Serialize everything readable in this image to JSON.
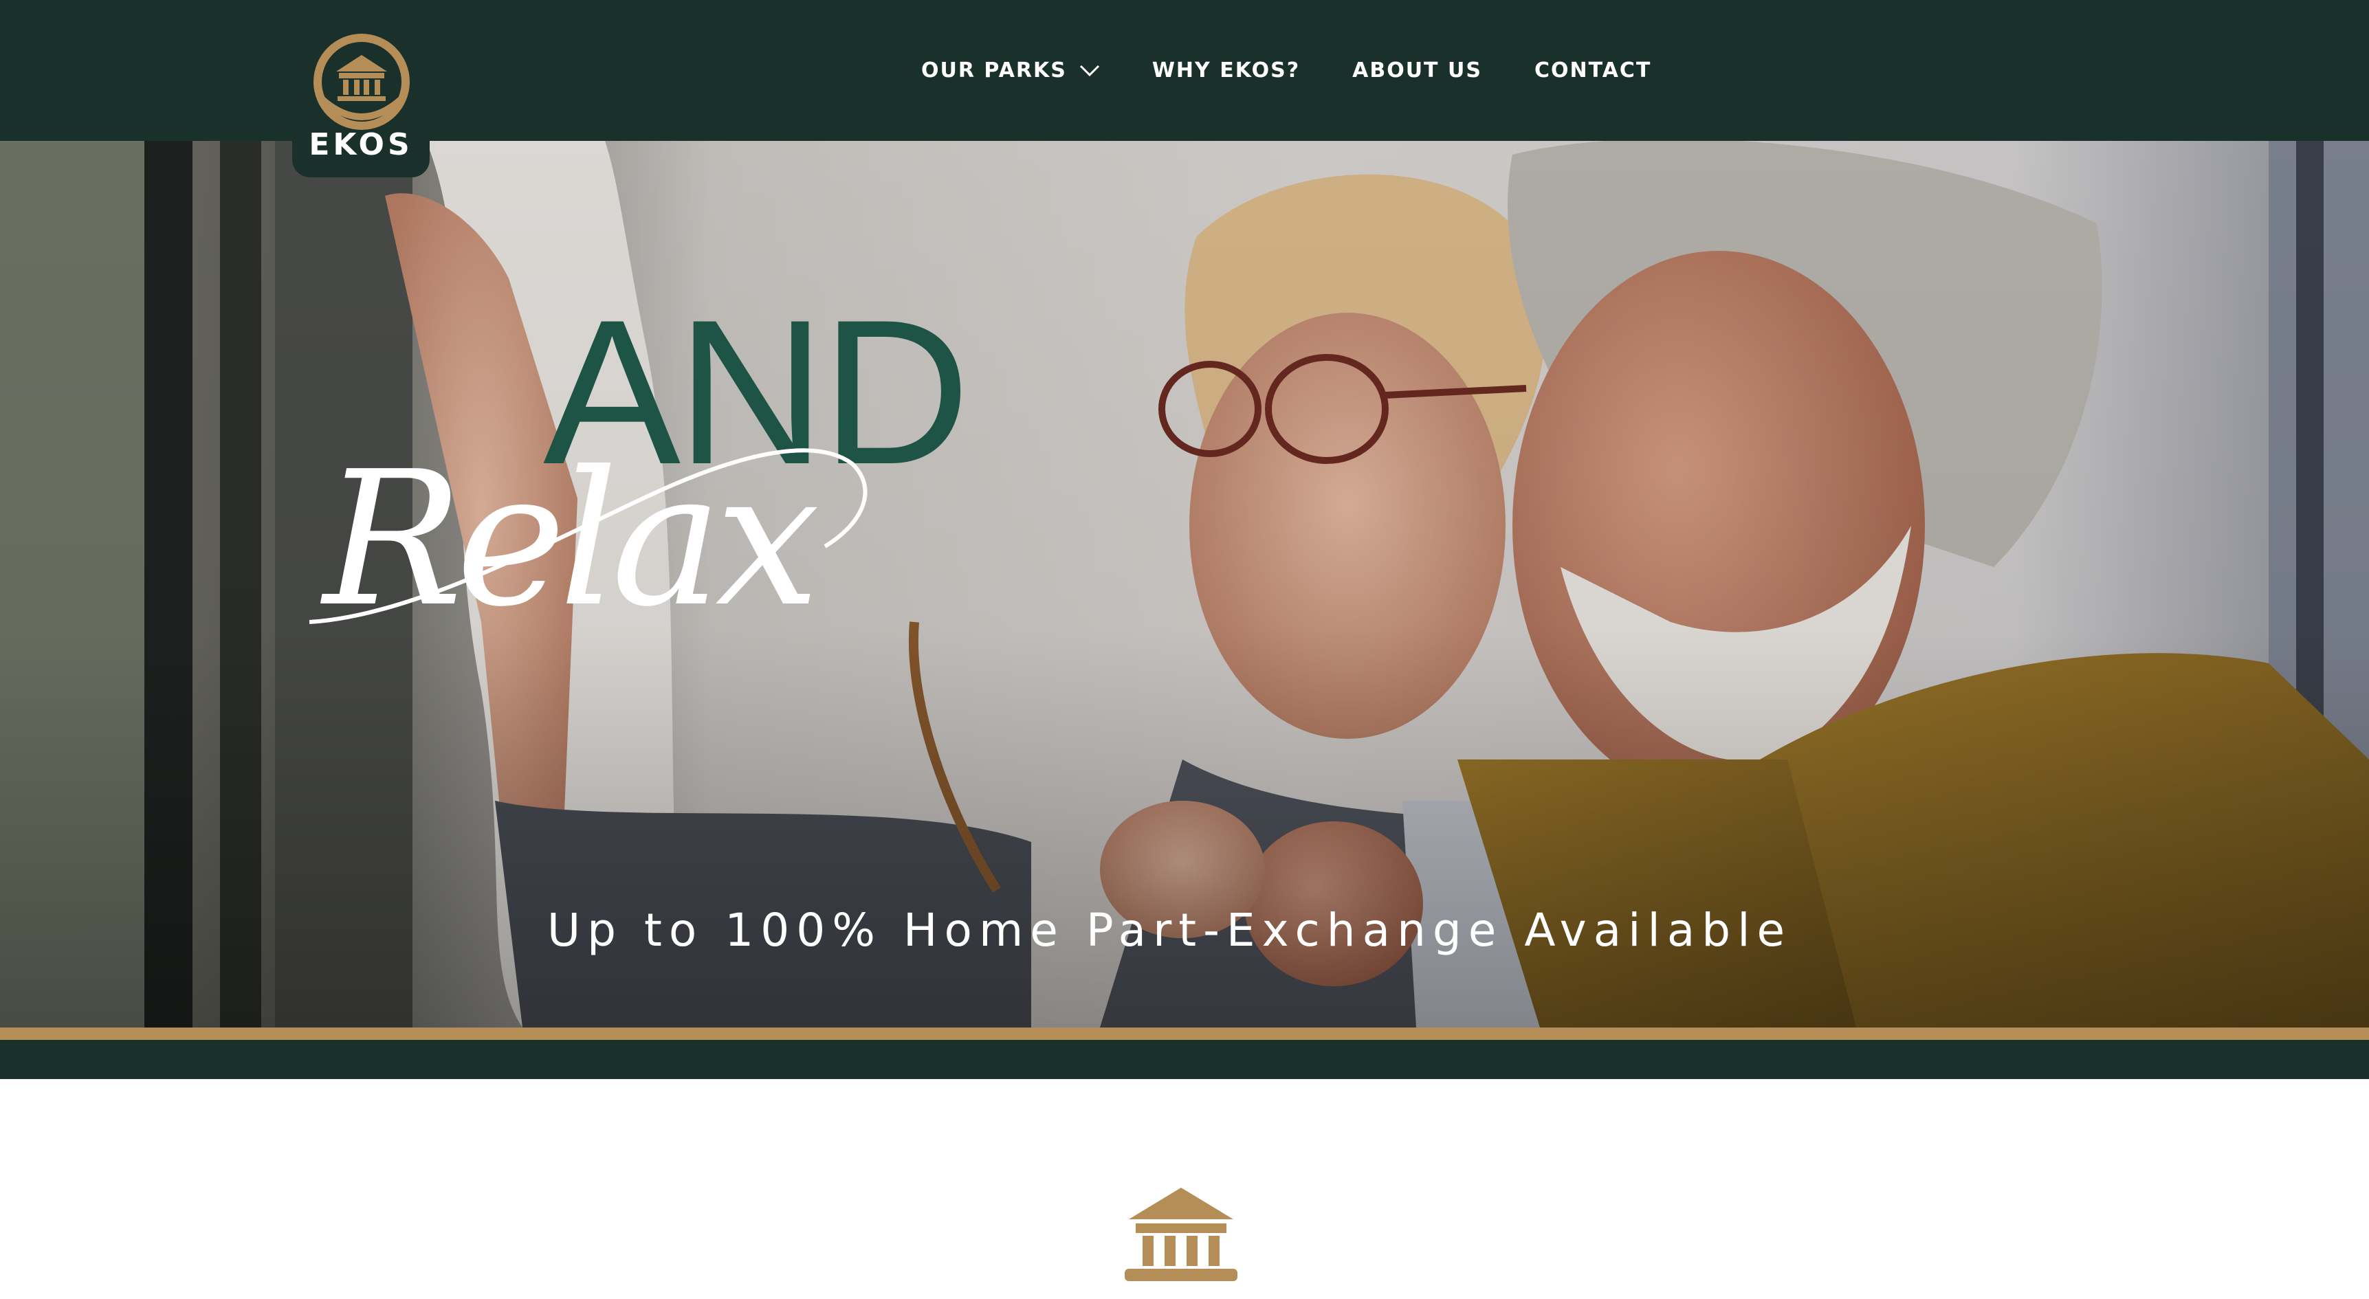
{
  "brand": {
    "name": "EKOS",
    "logo_icon": "building-emblem-icon",
    "colors": {
      "primary": "#1a302b",
      "accent": "#b48d57",
      "headline_green": "#1e5446"
    }
  },
  "nav": {
    "items": [
      {
        "label": "OUR PARKS",
        "has_dropdown": true,
        "dropdown_icon": "chevron-down-icon"
      },
      {
        "label": "WHY EKOS?",
        "has_dropdown": false
      },
      {
        "label": "ABOUT US",
        "has_dropdown": false
      },
      {
        "label": "CONTACT",
        "has_dropdown": false
      }
    ]
  },
  "hero": {
    "headline_top": "AND",
    "headline_script": "Relax",
    "tagline": "Up to 100% Home Part-Exchange Available",
    "image_subject": "couple-hug-photo"
  },
  "section_icon": "building-icon"
}
